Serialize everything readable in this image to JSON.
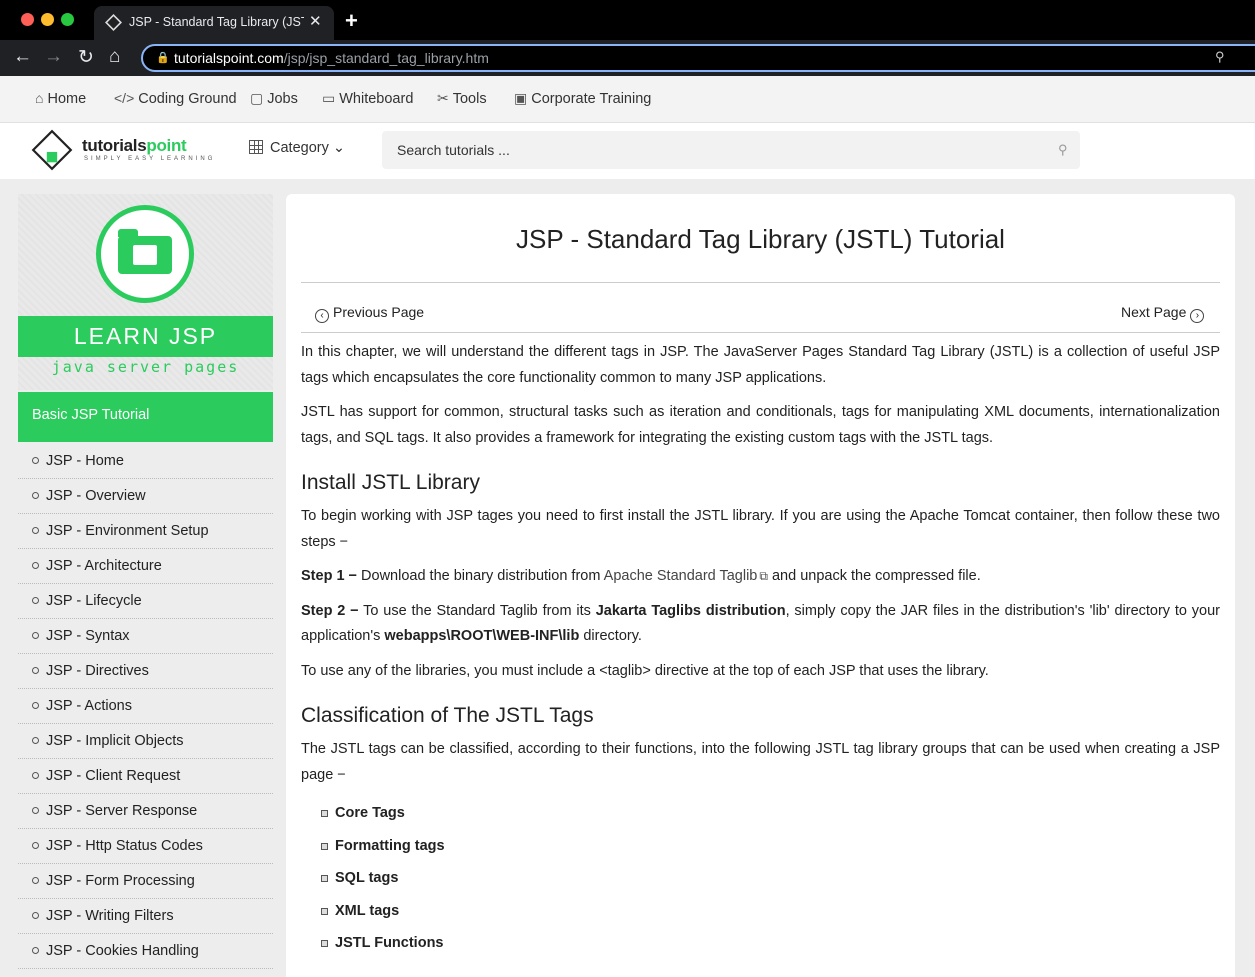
{
  "browser": {
    "tab_title": "JSP - Standard Tag Library (JSTL) Tutorial",
    "url_host": "tutorialspoint.com",
    "url_path": "/jsp/jsp_standard_tag_library.htm"
  },
  "bookmarks": [
    {
      "label": "Home",
      "icon": "home-icon"
    },
    {
      "label": "Coding Ground",
      "icon": "code-icon"
    },
    {
      "label": "Jobs",
      "icon": "briefcase-icon"
    },
    {
      "label": "Whiteboard",
      "icon": "whiteboard-icon"
    },
    {
      "label": "Tools",
      "icon": "tools-icon"
    },
    {
      "label": "Corporate Training",
      "icon": "training-icon"
    }
  ],
  "header": {
    "logo_main": "tutorials",
    "logo_accent": "point",
    "logo_tagline": "SIMPLY EASY LEARNING",
    "category_label": "Category",
    "search_placeholder": "Search tutorials ..."
  },
  "sidebar": {
    "banner_title": "LEARN JSP",
    "banner_subtitle": "java server pages",
    "section_title": "Basic JSP Tutorial",
    "items": [
      "JSP - Home",
      "JSP - Overview",
      "JSP - Environment Setup",
      "JSP - Architecture",
      "JSP - Lifecycle",
      "JSP - Syntax",
      "JSP - Directives",
      "JSP - Actions",
      "JSP - Implicit Objects",
      "JSP - Client Request",
      "JSP - Server Response",
      "JSP - Http Status Codes",
      "JSP - Form Processing",
      "JSP - Writing Filters",
      "JSP - Cookies Handling"
    ]
  },
  "main": {
    "title": "JSP - Standard Tag Library (JSTL) Tutorial",
    "prev_label": "Previous Page",
    "next_label": "Next Page",
    "intro_p1": "In this chapter, we will understand the different tags in JSP. The JavaServer Pages Standard Tag Library (JSTL) is a collection of useful JSP tags which encapsulates the core functionality common to many JSP applications.",
    "intro_p2": "JSTL has support for common, structural tasks such as iteration and conditionals, tags for manipulating XML documents, internationalization tags, and SQL tags. It also provides a framework for integrating the existing custom tags with the JSTL tags.",
    "h_install": "Install JSTL Library",
    "install_p": "To begin working with JSP tages you need to first install the JSTL library. If you are using the Apache Tomcat container, then follow these two steps −",
    "step1_label": "Step 1 −",
    "step1_before": " Download the binary distribution from ",
    "step1_link": "Apache Standard Taglib",
    "step1_after": " and unpack the compressed file.",
    "step2_label": "Step 2 −",
    "step2_a": " To use the Standard Taglib from its ",
    "step2_b": "Jakarta Taglibs distribution",
    "step2_c": ", simply copy the JAR files in the distribution's 'lib' directory to your application's ",
    "step2_d": "webapps\\ROOT\\WEB-INF\\lib",
    "step2_e": " directory.",
    "taglib_p": "To use any of the libraries, you must include a <taglib> directive at the top of each JSP that uses the library.",
    "h_classification": "Classification of The JSTL Tags",
    "class_p": "The JSTL tags can be classified, according to their functions, into the following JSTL tag library groups that can be used when creating a JSP page −",
    "groups": [
      "Core Tags",
      "Formatting tags",
      "SQL tags",
      "XML tags",
      "JSTL Functions"
    ]
  },
  "colors": {
    "brand_green": "#2bcc5d",
    "omnibox_focus": "#8ab4f8"
  }
}
